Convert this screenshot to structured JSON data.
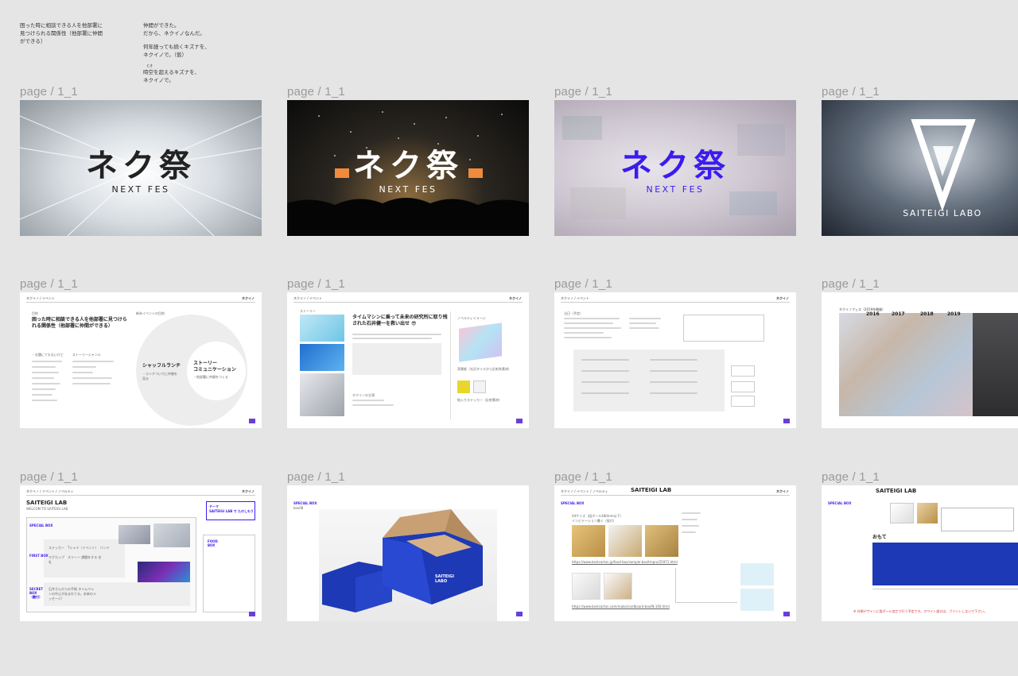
{
  "notes": {
    "left": "困った時に相談できる人を他部署に\n見つけられる関係性（他部署に仲間\nができる）",
    "right_1": "仲間ができた。\nだから、ネクイノなんだ。",
    "right_2": "何年経っても続くキズナを、\nネクイノで。（仮）",
    "right_3_ruby": "とき",
    "right_3": "時空を超えるキズナを、\nネクイノで。"
  },
  "pages": [
    {
      "label": "page / 1_1",
      "title": "ネク祭",
      "subtitle": "NEXT FES"
    },
    {
      "label": "page / 1_1",
      "title": "ネク祭",
      "subtitle": "NEXT FES"
    },
    {
      "label": "page / 1_1",
      "title": "ネク祭",
      "subtitle": "NEXT FES"
    },
    {
      "label": "page / 1_1",
      "title": "SAITEIGI LABO"
    },
    {
      "label": "page / 1_1",
      "header": "ネクイノ / イベント",
      "brand": "ネクイノ",
      "small": "目的",
      "heading": "困った時に相談できる人を他部署に見つけられる関係性（他部署に仲間ができる）",
      "side": "新年イベントの目的",
      "c1": "シャッフルランチ",
      "c1sub": "・ランチついでに仲間を見る",
      "c2": "ストーリー\nコミュニケーション",
      "c2sub": "・他部署に仲間をつくる",
      "list_a_title": "・お題にてもないけど",
      "list_b_title": "ストーリージャンル"
    },
    {
      "label": "page / 1_1",
      "header": "ネクイノ / イベント",
      "brand": "ネクイノ",
      "story": "ストーリー",
      "heading": "タイムマシンに乗って未来の研究所に取り残された石井健一を救い出せ 😎",
      "novelty": "ノベルティイメージ",
      "n1": "背景紙（光沢タイルから反射系素材）",
      "n2": "絵入りステッカー（反射素材）",
      "sub": "ネクイノの主演"
    },
    {
      "label": "page / 1_1",
      "header": "ネクイノ / イベント",
      "brand": "ネクイノ",
      "title": "当日（予定）"
    },
    {
      "label": "page / 1_1",
      "header": "ネクイノフェス（2019年開催）",
      "years": [
        "2016",
        "2017",
        "2018",
        "2019"
      ]
    },
    {
      "label": "page / 1_1",
      "header": "ネクイノ / イベント / ノベルティ",
      "brand": "ネクイノ",
      "title": "SAITEIGI LAB",
      "sub": "WELCOM TO SAITEIGI LAB",
      "special": "SPECIAL BOX",
      "theme": "テーマ\nSAITEIGI LAB で たのしもう",
      "food": "FOOD BOX",
      "first": "FIRST BOX",
      "secret": "SECRET BOX（鍵付）",
      "items1": "ステッカー　Tシャツ（イベント）　バンド",
      "items2": "マグカップ　スリーー 課題をする 名札",
      "items3": "石井さんからの手紙 タイムマシンの中止があまれてる。未来のメッセージ!"
    },
    {
      "label": "page / 1_1",
      "special": "SPECIAL BOX",
      "sub": "box08",
      "box_text": "SAITEIGI\nLABO"
    },
    {
      "label": "page / 1_1",
      "header": "ネクイノ / イベント / ノベルティ",
      "brand": "ネクイノ",
      "title": "SAITEIGI LAB",
      "special": "SPECIAL BOX",
      "item": "A4サイズ（段ボール480mm以下）\nインビテーション書く（仮付）",
      "link1": "https://www.bestcarton.jp/food-box/sample-box/tmpro/25971.html",
      "link2": "https://www.bestcarton.com/make/cardboard-box/N-100.html"
    },
    {
      "label": "page / 1_1",
      "special": "SPECIAL BOX",
      "title": "SAITEIGI LAB",
      "front": "おもて",
      "note": "※ 外側デザインに段ボール加工で行う予定です。ホワイト部分は、プリントしないで下さい。"
    }
  ],
  "colors": {
    "accent": "#3a1cf0",
    "brand_purple": "#6a3fd9",
    "box_blue": "#1d39b5"
  }
}
